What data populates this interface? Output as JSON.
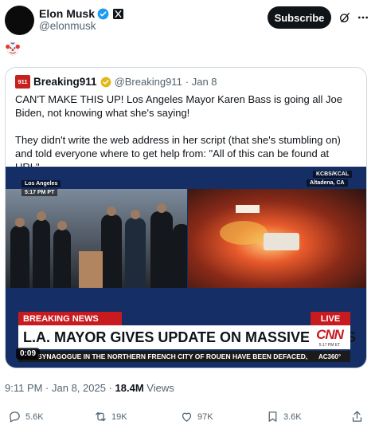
{
  "post": {
    "author_name": "Elon Musk",
    "author_handle": "@elonmusk",
    "subscribe_label": "Subscribe",
    "emoji": "clown-face",
    "timestamp": "9:11 PM · Jan 8, 2025",
    "views_count": "18.4M",
    "views_label": "Views"
  },
  "quote": {
    "logo_text": "911",
    "name": "Breaking911",
    "handle": "@Breaking911",
    "date": "· Jan 8",
    "paragraph1": "CAN'T MAKE THIS UP! Los Angeles Mayor Karen Bass is going all Joe Biden, not knowing what she's saying!",
    "paragraph2": "They didn't write the web address in her script (that she's stumbling on) and told everyone where to get help from: \"All of this can be found at URL\"..."
  },
  "video": {
    "location_left": "Los Angeles",
    "time_left": "5:17 PM PT",
    "station": "KCBS/KCAL",
    "location_right": "Altadena, CA",
    "breaking_label": "BREAKING NEWS",
    "live_label": "LIVE",
    "headline": "L.A. MAYOR GIVES UPDATE ON MASSIVE FIRES",
    "network": "CNN",
    "network_time": "5:17 PM ET",
    "ticker": "SYNAGOGUE IN THE NORTHERN FRENCH CITY OF ROUEN HAVE BEEN DEFACED,",
    "show_tag": "AC360°",
    "duration": "0:09"
  },
  "actions": {
    "replies": "5.6K",
    "reposts": "19K",
    "likes": "97K",
    "bookmarks": "3.6K"
  },
  "colors": {
    "accent_dark": "#0f1419",
    "muted": "#536471",
    "verified_blue": "#1d9bf0",
    "gold": "#e2b719",
    "cnn_red": "#c81b1f"
  }
}
